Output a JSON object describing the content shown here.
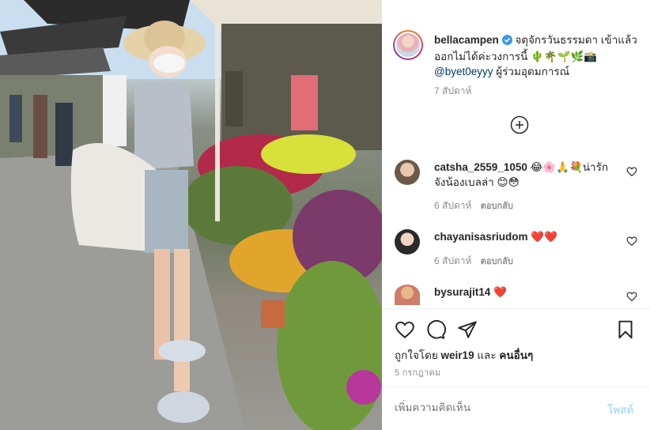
{
  "post": {
    "username": "bellacampen",
    "caption_line1": "จตุจักรวันธรรมดา เข้าแล้วออกไม่ได้ค่ะวงการนี้ 🌵🌴🌱🌿📸",
    "caption_mention": "@byet0eyyy",
    "caption_line2": " ผู้ร่วมอุดมการณ์",
    "time": "7 สัปดาห์"
  },
  "comments": [
    {
      "username": "catsha_2559_1050",
      "text": "😂🌸🙏💐น่ารักจังน้องเบลล่า 😊😳",
      "time": "6 สัปดาห์",
      "reply": "ตอบกลับ"
    },
    {
      "username": "chayanisasriudom",
      "text": "❤️❤️",
      "time": "6 สัปดาห์",
      "reply": "ตอบกลับ"
    },
    {
      "username": "bysurajit14",
      "text": "❤️"
    }
  ],
  "likes": {
    "prefix": "ถูกใจโดย",
    "user": "weir19",
    "joiner": "และ",
    "others": "คนอื่นๆ"
  },
  "date": "5 กรกฎาคม",
  "comment_box": {
    "placeholder": "เพิ่มความคิดเห็น",
    "post_label": "โพสต์"
  },
  "colors": {
    "link": "#00376b",
    "post_button": "#b2dffc",
    "verified": "#3897f0",
    "heart": "#ed4956"
  },
  "icons": [
    "heart-icon",
    "comment-icon",
    "share-icon",
    "bookmark-icon",
    "add-circle-icon",
    "verified-icon"
  ]
}
